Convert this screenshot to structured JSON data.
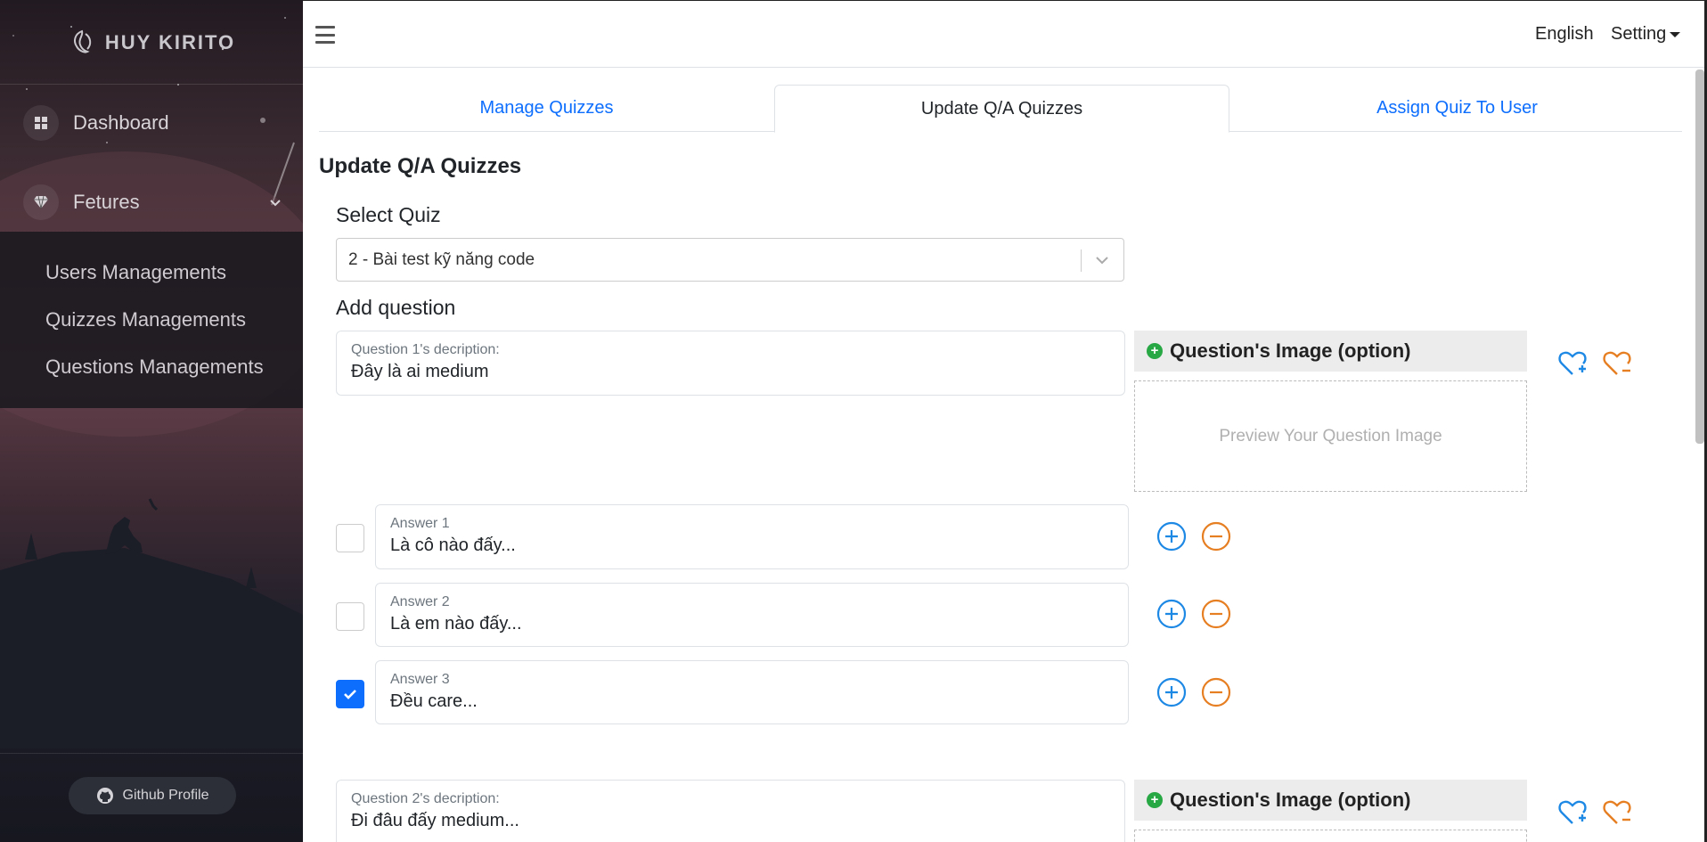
{
  "brand": {
    "name": "HUY KIRITO"
  },
  "sidebar": {
    "dashboard_label": "Dashboard",
    "features_label": "Fetures",
    "submenu": [
      "Users Managements",
      "Quizzes Managements",
      "Questions Managements"
    ],
    "github_label": "Github Profile"
  },
  "topbar": {
    "language": "English",
    "setting": "Setting"
  },
  "tabs": [
    {
      "label": "Manage Quizzes",
      "active": false
    },
    {
      "label": "Update Q/A Quizzes",
      "active": true
    },
    {
      "label": "Assign Quiz To User",
      "active": false
    }
  ],
  "page": {
    "title": "Update Q/A Quizzes",
    "select_label": "Select Quiz",
    "selected_quiz": "2 - Bài test kỹ năng code",
    "add_question_label": "Add question"
  },
  "questions": [
    {
      "label": "Question 1's decription:",
      "value": "Đây là ai medium",
      "image_header": "Question's Image (option)",
      "preview_text": "Preview Your Question Image",
      "answers": [
        {
          "label": "Answer 1",
          "value": "Là cô nào đấy...",
          "correct": false
        },
        {
          "label": "Answer 2",
          "value": "Là em nào đấy...",
          "correct": false
        },
        {
          "label": "Answer 3",
          "value": "Đều care...",
          "correct": true
        }
      ]
    },
    {
      "label": "Question 2's decription:",
      "value": "Đi đâu đấy medium...",
      "image_header": "Question's Image (option)"
    }
  ],
  "colors": {
    "primary": "#0d6efd",
    "add": "#1e88e5",
    "remove": "#e67e22",
    "green": "#28a745"
  }
}
